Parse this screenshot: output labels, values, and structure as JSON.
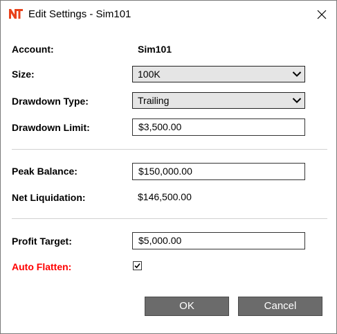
{
  "window": {
    "title": "Edit Settings - Sim101",
    "logo_icon": "ninjatrader-logo-icon",
    "close_icon": "close-icon"
  },
  "colors": {
    "logo_accent": "#e8421b",
    "auto_flatten_label": "#ff0000",
    "button_bg": "#6b6b6b",
    "select_bg": "#e5e5e5"
  },
  "form": {
    "account_label": "Account:",
    "account_value": "Sim101",
    "size_label": "Size:",
    "size_value": "100K",
    "drawdown_type_label": "Drawdown Type:",
    "drawdown_type_value": "Trailing",
    "drawdown_limit_label": "Drawdown Limit:",
    "drawdown_limit_value": "$3,500.00",
    "peak_balance_label": "Peak Balance:",
    "peak_balance_value": "$150,000.00",
    "net_liquidation_label": "Net Liquidation:",
    "net_liquidation_value": "$146,500.00",
    "profit_target_label": "Profit Target:",
    "profit_target_value": "$5,000.00",
    "auto_flatten_label": "Auto Flatten:",
    "auto_flatten_checked": true
  },
  "buttons": {
    "ok_label": "OK",
    "cancel_label": "Cancel"
  }
}
